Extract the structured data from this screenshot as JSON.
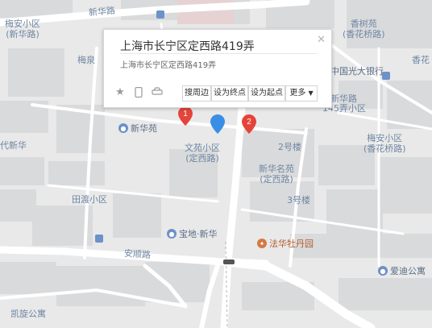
{
  "popup": {
    "title": "上海市长宁区定西路419弄",
    "address": "上海市长宁区定西路419弄",
    "close_icon": "close-icon",
    "buttons": {
      "nearby": "搜周边",
      "set_end": "设为终点",
      "set_start": "设为起点",
      "more": "更多"
    }
  },
  "markers": {
    "one": "1",
    "two": "2"
  },
  "labels": {
    "xinhua_road": "新华路",
    "meian_1": "梅安小区",
    "meian_1b": "(新华路)",
    "xiangshu_1": "香树苑",
    "xiangshu_1b": "(香花桥路)",
    "meiquan": "梅泉",
    "xiangh": "香花",
    "xinhuayuan": "新华苑",
    "gdyh": "中国光大银行",
    "xinhua2": "新华路",
    "lane145": "145弄小区",
    "meian_2": "梅安小区",
    "meian_2b": "(香花桥路)",
    "era": "代新华",
    "wenyuan": "文苑小区",
    "wenyuan_b": "(定西路)",
    "bldg2": "2号楼",
    "xinhuamingyuan": "新华名苑",
    "xinhuamingyuan_b": "(定西路)",
    "bldg3": "3号楼",
    "tianjing": "田渡小区",
    "baodi": "宝地·新华",
    "fahua": "法华牡丹园",
    "anshun": "安顺路",
    "aidi": "爱迪公寓",
    "kaixuan": "凯旋公寓"
  },
  "colors": {
    "road": "#ffffff",
    "block": "#d9dadb",
    "background": "#e9e9e9",
    "marker_red": "#e5443a",
    "marker_blue": "#3a8ee6"
  }
}
